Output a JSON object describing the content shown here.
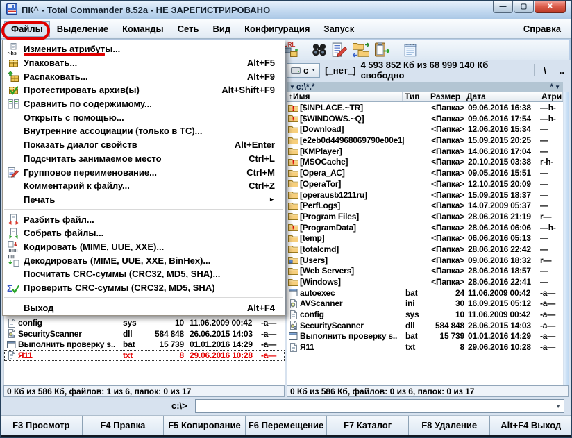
{
  "colors": {
    "annotation_red": "#e00000",
    "selected_file_red": "#e60000"
  },
  "window": {
    "title": "ПК^ - Total Commander 8.52a - НЕ ЗАРЕГИСТРИРОВАНО",
    "buttons": {
      "minimize": "—",
      "maximize": "▢",
      "close": "✕"
    }
  },
  "menubar": {
    "items": [
      "Файлы",
      "Выделение",
      "Команды",
      "Сеть",
      "Вид",
      "Конфигурация",
      "Запуск"
    ],
    "open_item": "Файлы",
    "right_item": "Справка"
  },
  "toolbar": {
    "icons": [
      "url-icon",
      "separator",
      "find-icon",
      "multi-rename-tool-icon",
      "sync-dirs-icon",
      "copy-clipboard-icon",
      "separator",
      "notepad-icon"
    ]
  },
  "files_menu": {
    "items": [
      {
        "label": "Изменить атрибуты...",
        "icon": "change-attributes-icon"
      },
      {
        "label": "Упаковать...",
        "shortcut": "Alt+F5",
        "icon": "pack-icon"
      },
      {
        "label": "Распаковать...",
        "shortcut": "Alt+F9",
        "icon": "unpack-icon"
      },
      {
        "label": "Протестировать архив(ы)",
        "shortcut": "Alt+Shift+F9",
        "icon": "test-archives-icon"
      },
      {
        "label": "Сравнить по содержимому...",
        "icon": "compare-contents-icon"
      },
      {
        "label": "Открыть с помощью..."
      },
      {
        "label": "Внутренние ассоциации (только в TC)..."
      },
      {
        "label": "Показать диалог свойств",
        "shortcut": "Alt+Enter"
      },
      {
        "label": "Подсчитать занимаемое место",
        "shortcut": "Ctrl+L"
      },
      {
        "label": "Групповое переименование...",
        "shortcut": "Ctrl+M",
        "icon": "multi-rename-icon"
      },
      {
        "label": "Комментарий к файлу...",
        "shortcut": "Ctrl+Z"
      },
      {
        "label": "Печать",
        "submenu": true
      },
      {
        "separator": true
      },
      {
        "label": "Разбить файл...",
        "icon": "split-file-icon"
      },
      {
        "label": "Собрать файлы...",
        "icon": "combine-files-icon"
      },
      {
        "label": "Кодировать (MIME, UUE, XXE)...",
        "icon": "encode-icon"
      },
      {
        "label": "Декодировать (MIME, UUE, XXE, BinHex)...",
        "icon": "decode-icon"
      },
      {
        "label": "Посчитать CRC-суммы (CRC32, MD5, SHA)..."
      },
      {
        "label": "Проверить CRC-суммы (CRC32, MD5, SHA)",
        "icon": "verify-crc-icon"
      },
      {
        "separator": true
      },
      {
        "label": "Выход",
        "shortcut": "Alt+F4"
      }
    ]
  },
  "right_panel": {
    "drive_letter": "c",
    "drive_label": "[_нет_]",
    "free_space": "4 593 852 Кб из 68 999 140 Кб свободно",
    "backslash_button": "\\",
    "up_button": "..",
    "path_dropdown": "▼",
    "path": "c:\\*.*",
    "history_button": "*",
    "hotlist_button": "▼",
    "sort_arrow": "↑",
    "columns": [
      "Имя",
      "Тип",
      "Размер",
      "Дата",
      "Атрибуты"
    ],
    "rows": [
      {
        "icon": "folder-warning-icon",
        "name": "[$INPLACE.~TR]",
        "type": "",
        "size": "<Папка>",
        "date": "09.06.2016 16:38",
        "attr": "—h-"
      },
      {
        "icon": "folder-warning-icon",
        "name": "[$WINDOWS.~Q]",
        "type": "",
        "size": "<Папка>",
        "date": "09.06.2016 17:54",
        "attr": "—h-"
      },
      {
        "icon": "folder-icon",
        "name": "[Download]",
        "type": "",
        "size": "<Папка>",
        "date": "12.06.2016 15:34",
        "attr": "—"
      },
      {
        "icon": "folder-icon",
        "name": "[e2eb0d44968069790e00e1]",
        "type": "",
        "size": "<Папка>",
        "date": "15.09.2015 20:25",
        "attr": "—"
      },
      {
        "icon": "folder-icon",
        "name": "[KMPlayer]",
        "type": "",
        "size": "<Папка>",
        "date": "14.06.2016 17:04",
        "attr": "—"
      },
      {
        "icon": "folder-warning-icon",
        "name": "[MSOCache]",
        "type": "",
        "size": "<Папка>",
        "date": "20.10.2015 03:38",
        "attr": "r-h-"
      },
      {
        "icon": "folder-icon",
        "name": "[Opera_AC]",
        "type": "",
        "size": "<Папка>",
        "date": "09.05.2016 15:51",
        "attr": "—"
      },
      {
        "icon": "folder-icon",
        "name": "[OperaTor]",
        "type": "",
        "size": "<Папка>",
        "date": "12.10.2015 20:09",
        "attr": "—"
      },
      {
        "icon": "folder-icon",
        "name": "[operausb1211ru]",
        "type": "",
        "size": "<Папка>",
        "date": "15.09.2015 18:37",
        "attr": "—"
      },
      {
        "icon": "folder-icon",
        "name": "[PerfLogs]",
        "type": "",
        "size": "<Папка>",
        "date": "14.07.2009 05:37",
        "attr": "—"
      },
      {
        "icon": "folder-icon",
        "name": "[Program Files]",
        "type": "",
        "size": "<Папка>",
        "date": "28.06.2016 21:19",
        "attr": "r—"
      },
      {
        "icon": "folder-warning-icon",
        "name": "[ProgramData]",
        "type": "",
        "size": "<Папка>",
        "date": "28.06.2016 06:06",
        "attr": "—h-"
      },
      {
        "icon": "folder-icon",
        "name": "[temp]",
        "type": "",
        "size": "<Папка>",
        "date": "06.06.2016 05:13",
        "attr": "—"
      },
      {
        "icon": "folder-icon",
        "name": "[totalcmd]",
        "type": "",
        "size": "<Папка>",
        "date": "28.06.2016 22:42",
        "attr": "—"
      },
      {
        "icon": "folder-shared-icon",
        "name": "[Users]",
        "type": "",
        "size": "<Папка>",
        "date": "09.06.2016 18:32",
        "attr": "r—"
      },
      {
        "icon": "folder-icon",
        "name": "[Web Servers]",
        "type": "",
        "size": "<Папка>",
        "date": "28.06.2016 18:57",
        "attr": "—"
      },
      {
        "icon": "folder-icon",
        "name": "[Windows]",
        "type": "",
        "size": "<Папка>",
        "date": "28.06.2016 22:41",
        "attr": "—"
      },
      {
        "icon": "file-bat-icon",
        "name": "autoexec",
        "type": "bat",
        "size": "24",
        "date": "11.06.2009 00:42",
        "attr": "-a—"
      },
      {
        "icon": "file-ini-icon",
        "name": "AVScanner",
        "type": "ini",
        "size": "30",
        "date": "16.09.2015 05:12",
        "attr": "-a—"
      },
      {
        "icon": "file-icon",
        "name": "config",
        "type": "sys",
        "size": "10",
        "date": "11.06.2009 00:42",
        "attr": "-a—"
      },
      {
        "icon": "file-dll-icon",
        "name": "SecurityScanner",
        "type": "dll",
        "size": "584 848",
        "date": "26.06.2015 14:03",
        "attr": "-a—"
      },
      {
        "icon": "file-bat-icon",
        "name": "Выполнить проверку s..",
        "type": "bat",
        "size": "15 739",
        "date": "01.01.2016 14:29",
        "attr": "-a—"
      },
      {
        "icon": "file-txt-icon",
        "name": "Я11",
        "type": "txt",
        "size": "8",
        "date": "29.06.2016 10:28",
        "attr": "-a—"
      }
    ],
    "status": "0 Кб из 586 Кб, файлов: 0 из 6, папок: 0 из 17"
  },
  "left_panel": {
    "rows": [
      {
        "icon": "file-icon",
        "name": "config",
        "type": "sys",
        "size": "10",
        "date": "11.06.2009 00:42",
        "attr": "-a—"
      },
      {
        "icon": "file-dll-icon",
        "name": "SecurityScanner",
        "type": "dll",
        "size": "584 848",
        "date": "26.06.2015 14:03",
        "attr": "-a—"
      },
      {
        "icon": "file-bat-icon",
        "name": "Выполнить проверку s..",
        "type": "bat",
        "size": "15 739",
        "date": "01.01.2016 14:29",
        "attr": "-a—"
      },
      {
        "icon": "file-txt-icon",
        "name": "Я11",
        "type": "txt",
        "size": "8",
        "date": "29.06.2016 10:28",
        "attr": "-a—",
        "selected": true
      }
    ],
    "status": "0 Кб из 586 Кб, файлов: 1 из 6, папок: 0 из 17"
  },
  "command_line": {
    "prompt": "c:\\>",
    "value": "",
    "dropdown": "▼"
  },
  "fkey_bar": {
    "buttons": [
      "F3 Просмотр",
      "F4 Правка",
      "F5 Копирование",
      "F6 Перемещение",
      "F7 Каталог",
      "F8 Удаление",
      "Alt+F4 Выход"
    ]
  }
}
